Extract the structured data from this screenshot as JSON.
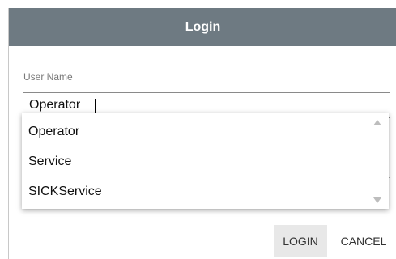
{
  "dialog": {
    "title": "Login",
    "field_label": "User Name",
    "field_value": "Operator"
  },
  "dropdown": {
    "options": [
      "Operator",
      "Service",
      "SICKService"
    ]
  },
  "actions": {
    "login_label": "LOGIN",
    "cancel_label": "CANCEL"
  },
  "colors": {
    "titlebar": "#6e7a82",
    "title_text": "#ffffff",
    "login_button_bg": "#e8e8e8"
  },
  "icons": {
    "scroll_up": "triangle-up-icon",
    "scroll_down": "triangle-down-icon"
  }
}
